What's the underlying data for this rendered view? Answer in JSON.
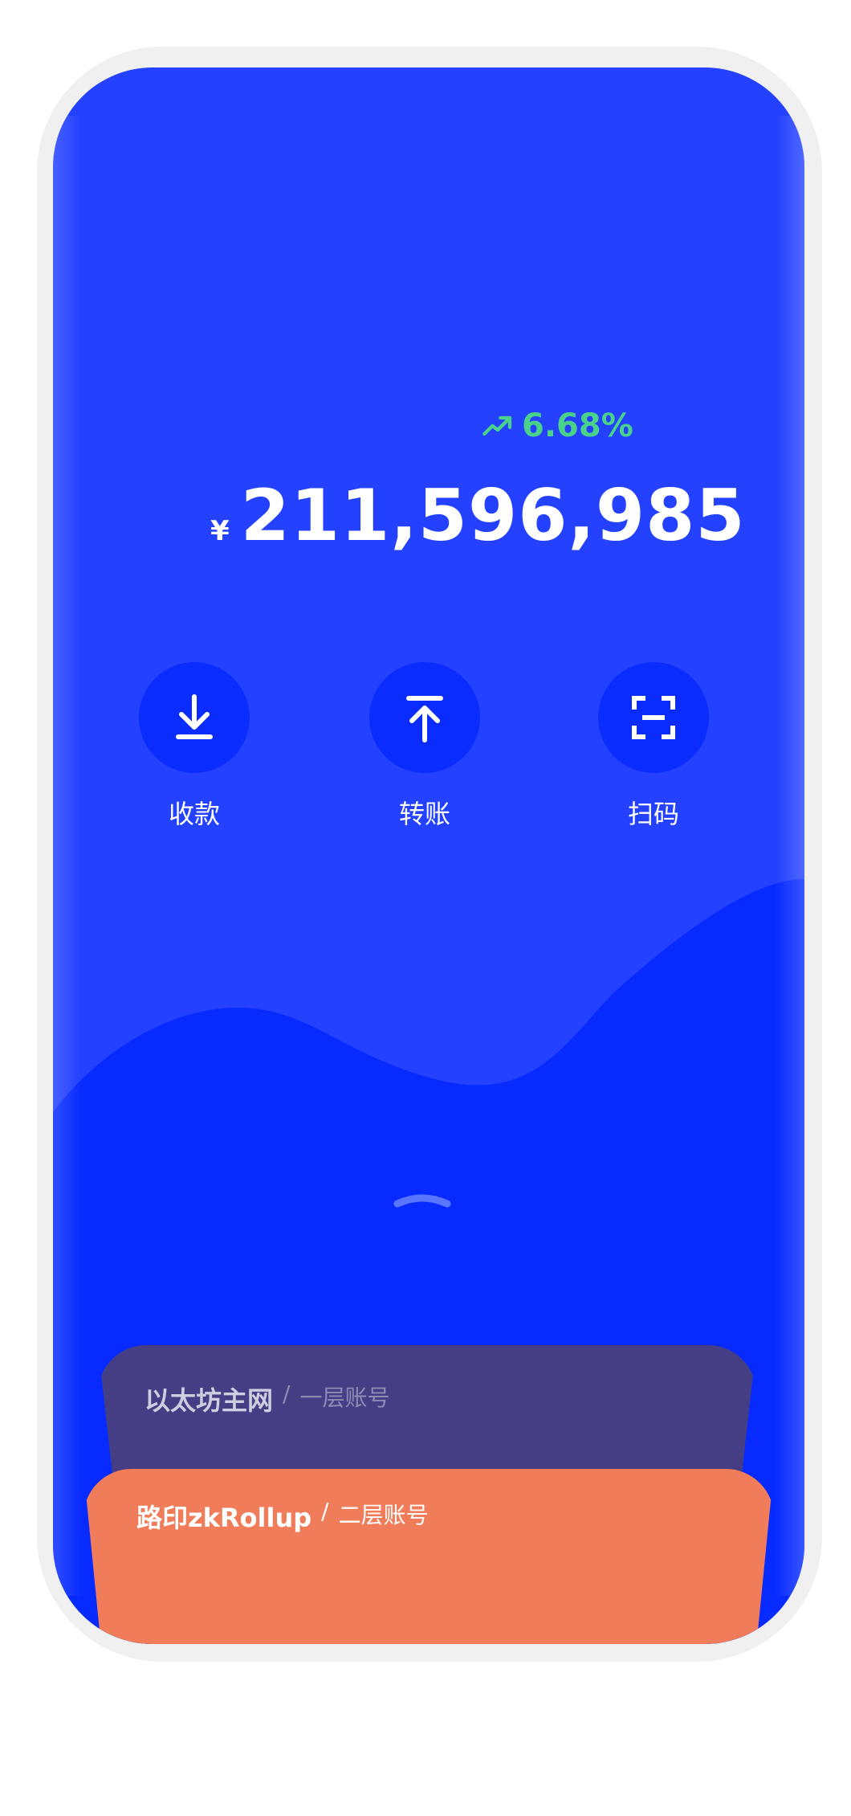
{
  "wallet": {
    "change": "6.68%",
    "currency": "¥",
    "balance": "211,596,985"
  },
  "actions": [
    {
      "label": "收款",
      "icon": "download-icon"
    },
    {
      "label": "转账",
      "icon": "upload-icon"
    },
    {
      "label": "扫码",
      "icon": "scan-icon"
    }
  ],
  "accounts": [
    {
      "name": "以太坊主网",
      "separator": "/",
      "type": "一层账号",
      "color": "#453e85"
    },
    {
      "name": "路印zkRollup",
      "separator": "/",
      "type": "二层账号",
      "color": "#f07c59"
    }
  ],
  "colors": {
    "background": "#2341ff",
    "action_circle": "#0b2cff",
    "positive": "#4ad18a"
  }
}
